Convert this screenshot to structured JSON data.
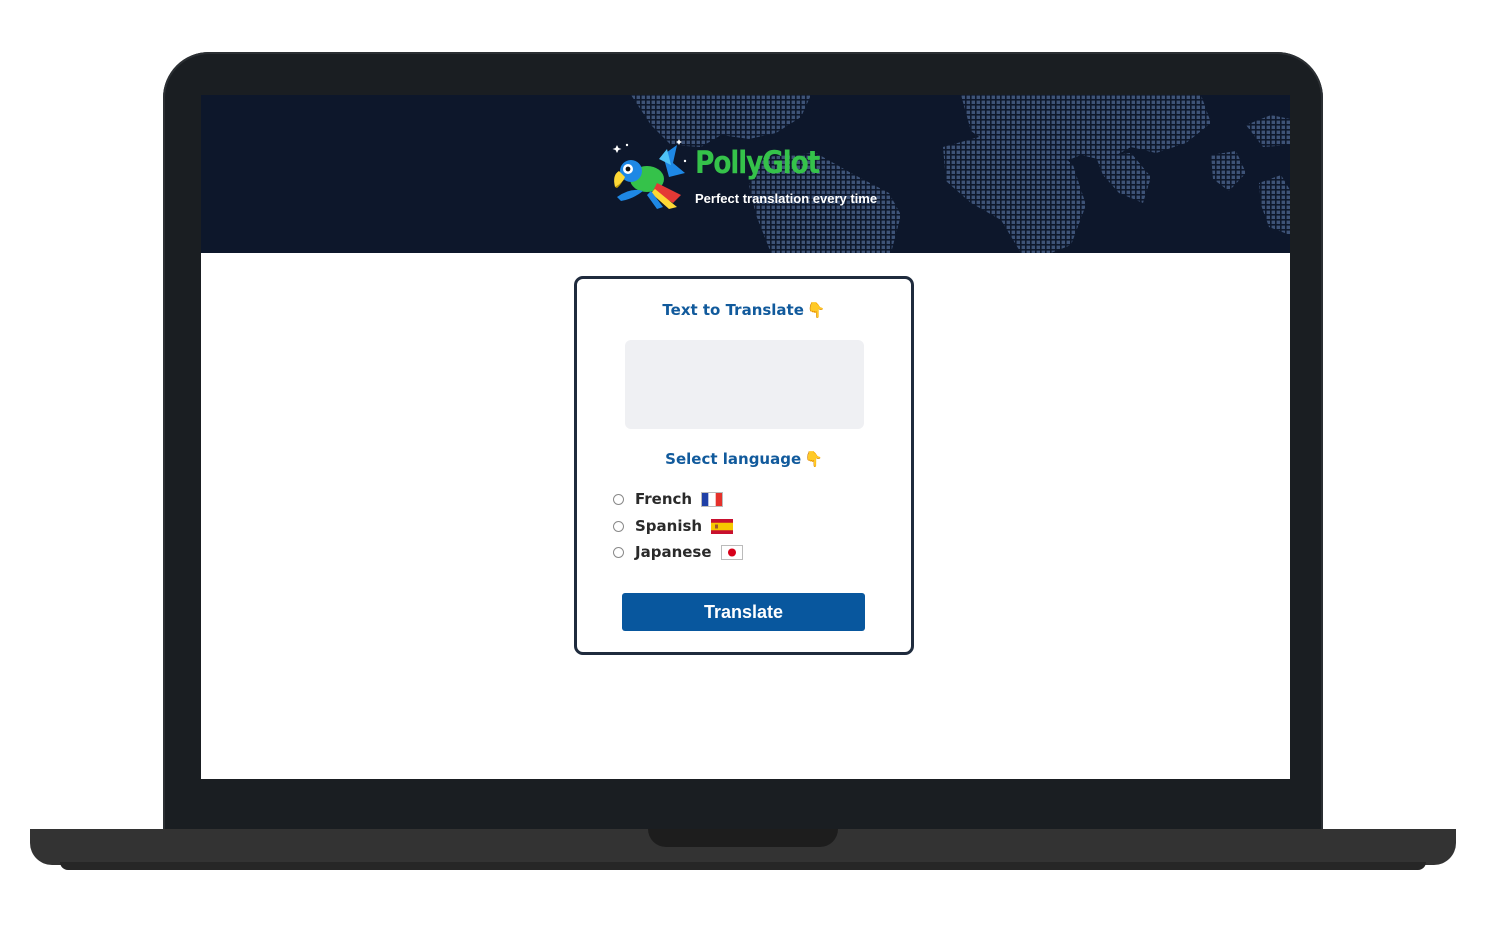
{
  "app": {
    "name": "PollyGlot",
    "tagline": "Perfect translation every time"
  },
  "form": {
    "text_label": "Text to Translate",
    "text_label_icon": "pointing-down-emoji",
    "text_value": "",
    "select_label": "Select language",
    "select_label_icon": "pointing-down-emoji",
    "languages": [
      {
        "label": "French",
        "flag": "flag-france",
        "selected": false
      },
      {
        "label": "Spanish",
        "flag": "flag-spain",
        "selected": false
      },
      {
        "label": "Japanese",
        "flag": "flag-japan",
        "selected": false
      }
    ],
    "button_label": "Translate"
  },
  "colors": {
    "header_bg": "#0d172b",
    "brand_green": "#35c24a",
    "label_blue": "#115a9c",
    "button_blue": "#08579e",
    "input_bg": "#eff0f3"
  }
}
